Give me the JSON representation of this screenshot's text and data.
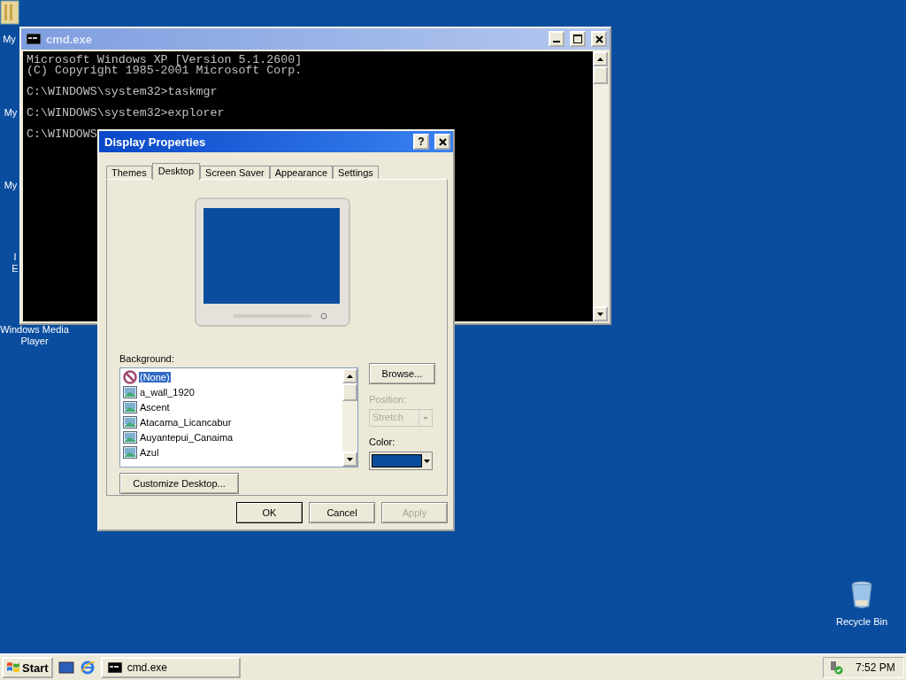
{
  "desktop_icons": [
    {
      "lines": [
        "My"
      ],
      "kind": "folder"
    },
    {
      "lines": [
        "My"
      ],
      "kind": "none"
    },
    {
      "lines": [
        "My"
      ],
      "kind": "none"
    },
    {
      "lines": [
        "I",
        "E"
      ],
      "kind": "none"
    },
    {
      "lines": [
        "Windows Media",
        "Player"
      ],
      "kind": "none"
    },
    {
      "lines": [
        "Recycle Bin"
      ],
      "kind": "bin"
    }
  ],
  "cmd_window": {
    "title": "cmd.exe",
    "console_blocks": [
      [
        "Microsoft Windows XP [Version 5.1.2600]",
        "(C) Copyright 1985-2001 Microsoft Corp."
      ],
      [
        "C:\\WINDOWS\\system32>taskmgr"
      ],
      [
        "C:\\WINDOWS\\system32>explorer"
      ],
      [
        "C:\\WINDOWS"
      ]
    ]
  },
  "dialog": {
    "title": "Display Properties",
    "help_button": "?",
    "tabs": [
      {
        "label": "Themes",
        "selected": false
      },
      {
        "label": "Desktop",
        "selected": true
      },
      {
        "label": "Screen Saver",
        "selected": false
      },
      {
        "label": "Appearance",
        "selected": false
      },
      {
        "label": "Settings",
        "selected": false
      }
    ],
    "background_label": "Background:",
    "backgrounds": [
      {
        "label": "(None)",
        "kind": "none",
        "selected": true
      },
      {
        "label": "a_wall_1920",
        "kind": "image",
        "selected": false
      },
      {
        "label": "Ascent",
        "kind": "image",
        "selected": false
      },
      {
        "label": "Atacama_Licancabur",
        "kind": "image",
        "selected": false
      },
      {
        "label": "Auyantepui_Canaima",
        "kind": "image",
        "selected": false
      },
      {
        "label": "Azul",
        "kind": "image",
        "selected": false
      }
    ],
    "browse_button": "Browse...",
    "position": {
      "label": "Position:",
      "value": "Stretch",
      "disabled": true
    },
    "color_label": "Color:",
    "customize_button": "Customize Desktop...",
    "buttons": [
      {
        "label": "OK",
        "disabled": false,
        "default": true
      },
      {
        "label": "Cancel",
        "disabled": false,
        "default": false
      },
      {
        "label": "Apply",
        "disabled": true,
        "default": false
      }
    ]
  },
  "taskbar": {
    "start": "Start",
    "tasks": [
      {
        "label": "cmd.exe",
        "selected": false
      }
    ],
    "clock": "7:52 PM"
  }
}
